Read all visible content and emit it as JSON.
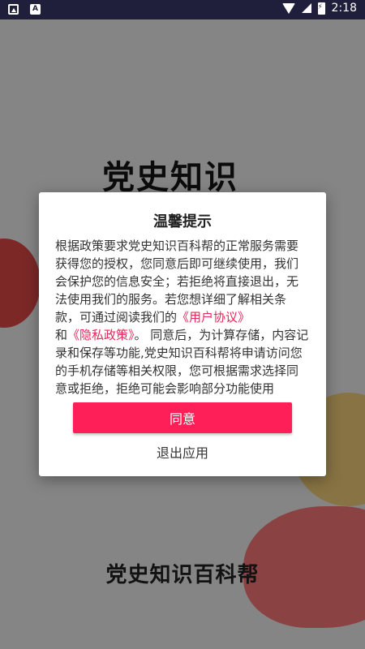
{
  "status_bar": {
    "time": "2:18",
    "left_icons": [
      "image-icon",
      "letter-a-icon"
    ],
    "right_icons": [
      "wifi-icon",
      "cell-signal-icon",
      "battery-charging-icon"
    ]
  },
  "splash": {
    "title_top": "党史知识",
    "title_bottom": "党史知识百科帮"
  },
  "dialog": {
    "title": "温馨提示",
    "body_part1": "根据政策要求党史知识百科帮的正常服务需要获得您的授权，您同意后即可继续使用，我们会保护您的信息安全；若拒绝将直接退出，无法使用我们的服务。若您想详细了解相关条款，可通过阅读我们的",
    "link_user_agreement": "《用户协议》",
    "and_text": "和",
    "link_privacy_policy": "《隐私政策》",
    "body_part2": "。 同意后，为计算存储，内容记录和保存等功能,党史知识百科帮将申请访问您的手机存储等相关权限，您可根据需求选择同意或拒绝，拒绝可能会影响部分功能使用",
    "agree_label": "同意",
    "exit_label": "退出应用"
  },
  "colors": {
    "status_bar_bg": "#1f1f3b",
    "accent": "#ff1f58",
    "link": "#e8275a"
  }
}
